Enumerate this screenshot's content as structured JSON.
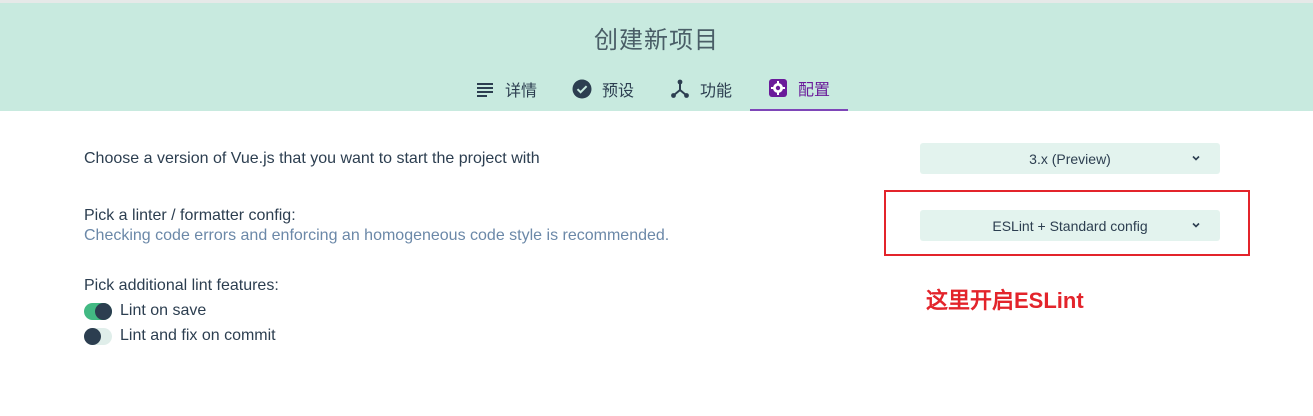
{
  "header": {
    "title": "创建新项目",
    "tabs": [
      {
        "label": "详情",
        "icon": "list-icon"
      },
      {
        "label": "预设",
        "icon": "check-circle-icon"
      },
      {
        "label": "功能",
        "icon": "fork-icon"
      },
      {
        "label": "配置",
        "icon": "settings-icon",
        "active": true
      }
    ]
  },
  "config": {
    "vue_version": {
      "label": "Choose a version of Vue.js that you want to start the project with",
      "selected": "3.x (Preview)"
    },
    "linter": {
      "label": "Pick a linter / formatter config:",
      "description": "Checking code errors and enforcing an homogeneous code style is recommended.",
      "selected": "ESLint + Standard config"
    },
    "lint_features": {
      "label": "Pick additional lint features:",
      "options": [
        {
          "label": "Lint on save",
          "enabled": true
        },
        {
          "label": "Lint and fix on commit",
          "enabled": false
        }
      ]
    }
  },
  "annotation": {
    "note": "这里开启ESLint",
    "color": "#e3242b"
  },
  "colors": {
    "header_bg": "#c8eadf",
    "accent_purple": "#6a1b9a",
    "toggle_on": "#42b983",
    "select_bg": "#e3f3ee"
  }
}
